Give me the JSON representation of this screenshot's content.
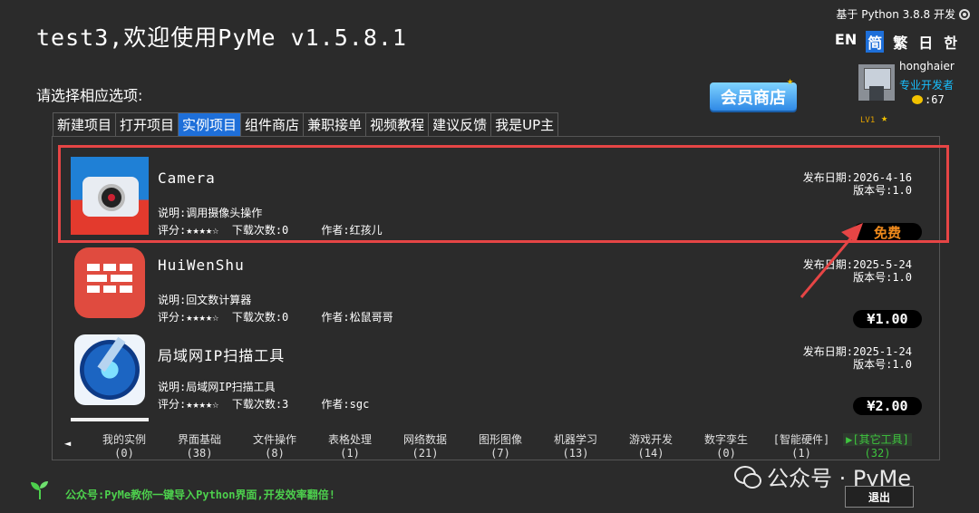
{
  "header": {
    "title": "test3,欢迎使用PyMe v1.5.8.1",
    "python_info": "基于 Python 3.8.8 开发",
    "prompt": "请选择相应选项:"
  },
  "languages": [
    "EN",
    "简",
    "繁",
    "日",
    "한"
  ],
  "shop_button": "会员商店",
  "user": {
    "name": "honghaier",
    "role": "专业开发者",
    "coins": ":67",
    "level": "LV1"
  },
  "tabs": [
    "新建项目",
    "打开项目",
    "实例项目",
    "组件商店",
    "兼职接单",
    "视频教程",
    "建议反馈",
    "我是UP主"
  ],
  "active_tab": "实例项目",
  "projects": [
    {
      "name": "Camera",
      "desc": "说明:调用摄像头操作",
      "rating": "评分:★★★★☆",
      "downloads": "下载次数:0",
      "author": "作者:红孩儿",
      "date": "发布日期:2026-4-16",
      "version": "版本号:1.0",
      "price": "免费",
      "icon": "camera-icon"
    },
    {
      "name": "HuiWenShu",
      "desc": "说明:回文数计算器",
      "rating": "评分:★★★★☆",
      "downloads": "下载次数:0",
      "author": "作者:松鼠哥哥",
      "date": "发布日期:2025-5-24",
      "version": "版本号:1.0",
      "price": "¥1.00",
      "icon": "brick-wall-icon"
    },
    {
      "name": "局域网IP扫描工具",
      "desc": "说明:局域网IP扫描工具",
      "rating": "评分:★★★★☆",
      "downloads": "下载次数:3",
      "author": "作者:sgc",
      "date": "发布日期:2025-1-24",
      "version": "版本号:1.0",
      "price": "¥2.00",
      "icon": "radar-scan-icon"
    }
  ],
  "categories": [
    {
      "label": "我的实例",
      "count": "(0)"
    },
    {
      "label": "界面基础",
      "count": "(38)"
    },
    {
      "label": "文件操作",
      "count": "(8)"
    },
    {
      "label": "表格处理",
      "count": "(1)"
    },
    {
      "label": "网络数据",
      "count": "(21)"
    },
    {
      "label": "图形图像",
      "count": "(7)"
    },
    {
      "label": "机器学习",
      "count": "(13)"
    },
    {
      "label": "游戏开发",
      "count": "(14)"
    },
    {
      "label": "数字孪生",
      "count": "(0)"
    },
    {
      "label": "[智能硬件]",
      "count": "(1)"
    },
    {
      "label": "▶[其它工具]",
      "count": "(32)"
    }
  ],
  "footer": {
    "note": "公众号:PyMe教你一键导入Python界面,开发效率翻倍!",
    "watermark": "公众号 · PyMe",
    "exit_label": "退出"
  },
  "colors": {
    "accent_blue": "#1e6fd9",
    "highlight_red": "#e64545",
    "free_orange": "#f08a1c",
    "active_green": "#3ec43e"
  }
}
